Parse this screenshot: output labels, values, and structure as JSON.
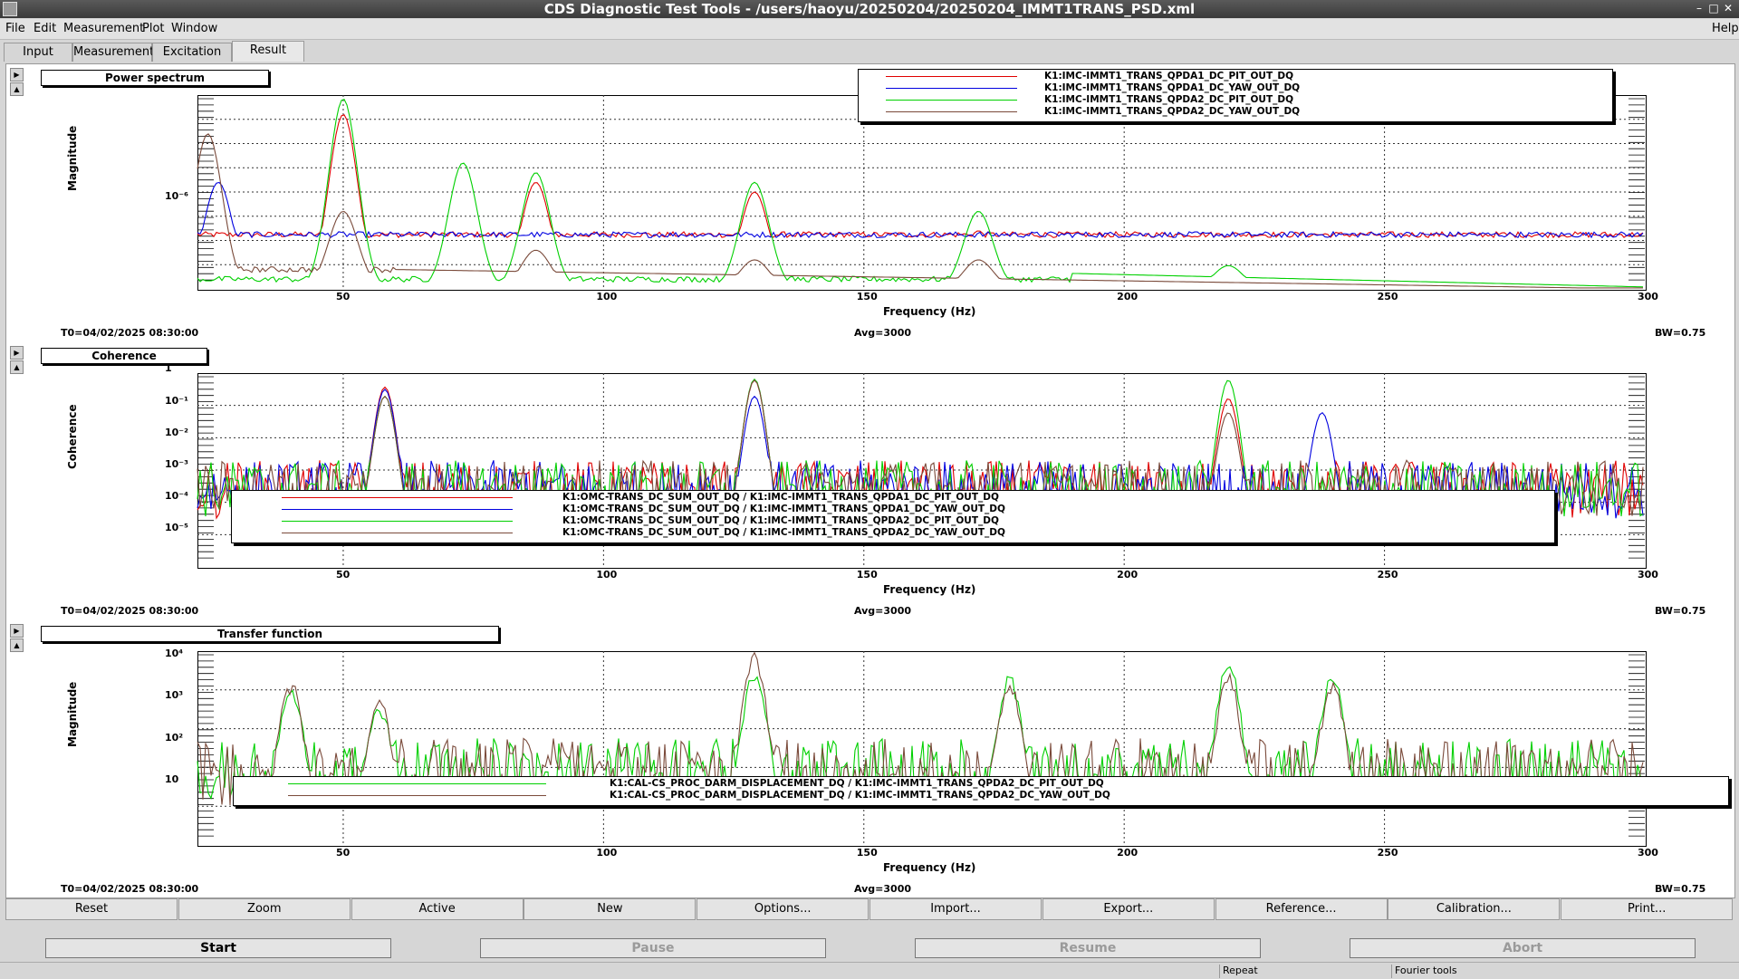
{
  "window": {
    "title": "CDS Diagnostic Test Tools - /users/haoyu/20250204/20250204_IMMT1TRANS_PSD.xml"
  },
  "menu": {
    "file": "File",
    "edit": "Edit",
    "measurement": "Measurement",
    "plot": "Plot",
    "window": "Window",
    "help": "Help"
  },
  "tabs": [
    {
      "label": "Input"
    },
    {
      "label": "Measurement"
    },
    {
      "label": "Excitation"
    },
    {
      "label": "Result",
      "active": true
    }
  ],
  "panels": [
    {
      "title": "Power spectrum",
      "ylabel": "Magnitude",
      "xlabel": "Frequency (Hz)",
      "xticks": [
        "50",
        "100",
        "150",
        "200",
        "250",
        "300"
      ],
      "yticks": [
        "10⁻⁶"
      ],
      "footer": {
        "t0": "T0=04/02/2025 08:30:00",
        "avg": "Avg=3000",
        "bw": "BW=0.75"
      },
      "legend": [
        {
          "label": "K1:IMC-IMMT1_TRANS_QPDA1_DC_PIT_OUT_DQ",
          "color": "#e00000"
        },
        {
          "label": "K1:IMC-IMMT1_TRANS_QPDA1_DC_YAW_OUT_DQ",
          "color": "#0000e0"
        },
        {
          "label": "K1:IMC-IMMT1_TRANS_QPDA2_DC_PIT_OUT_DQ",
          "color": "#00d000"
        },
        {
          "label": "K1:IMC-IMMT1_TRANS_QPDA2_DC_YAW_OUT_DQ",
          "color": "#7a4a3a"
        }
      ]
    },
    {
      "title": "Coherence",
      "ylabel": "Coherence",
      "xlabel": "Frequency (Hz)",
      "xticks": [
        "50",
        "100",
        "150",
        "200",
        "250",
        "300"
      ],
      "yticks": [
        "1",
        "10⁻¹",
        "10⁻²",
        "10⁻³",
        "10⁻⁴",
        "10⁻⁵"
      ],
      "footer": {
        "t0": "T0=04/02/2025 08:30:00",
        "avg": "Avg=3000",
        "bw": "BW=0.75"
      },
      "legend": [
        {
          "label": "K1:OMC-TRANS_DC_SUM_OUT_DQ / K1:IMC-IMMT1_TRANS_QPDA1_DC_PIT_OUT_DQ",
          "color": "#e00000"
        },
        {
          "label": "K1:OMC-TRANS_DC_SUM_OUT_DQ / K1:IMC-IMMT1_TRANS_QPDA1_DC_YAW_OUT_DQ",
          "color": "#0000e0"
        },
        {
          "label": "K1:OMC-TRANS_DC_SUM_OUT_DQ / K1:IMC-IMMT1_TRANS_QPDA2_DC_PIT_OUT_DQ",
          "color": "#00d000"
        },
        {
          "label": "K1:OMC-TRANS_DC_SUM_OUT_DQ / K1:IMC-IMMT1_TRANS_QPDA2_DC_YAW_OUT_DQ",
          "color": "#7a4a3a"
        }
      ]
    },
    {
      "title": "Transfer function",
      "ylabel": "Magnitude",
      "xlabel": "Frequency (Hz)",
      "xticks": [
        "50",
        "100",
        "150",
        "200",
        "250",
        "300"
      ],
      "yticks": [
        "10⁴",
        "10³",
        "10²",
        "10"
      ],
      "footer": {
        "t0": "T0=04/02/2025 08:30:00",
        "avg": "Avg=3000",
        "bw": "BW=0.75"
      },
      "legend": [
        {
          "label": "K1:CAL-CS_PROC_DARM_DISPLACEMENT_DQ / K1:IMC-IMMT1_TRANS_QPDA2_DC_PIT_OUT_DQ",
          "color": "#00d000"
        },
        {
          "label": "K1:CAL-CS_PROC_DARM_DISPLACEMENT_DQ / K1:IMC-IMMT1_TRANS_QPDA2_DC_YAW_OUT_DQ",
          "color": "#7a4a3a"
        }
      ]
    }
  ],
  "toolbar": [
    "Reset",
    "Zoom",
    "Active",
    "New",
    "Options...",
    "Import...",
    "Export...",
    "Reference...",
    "Calibration...",
    "Print..."
  ],
  "controls": {
    "start": "Start",
    "pause": "Pause",
    "resume": "Resume",
    "abort": "Abort"
  },
  "status": {
    "repeat": "Repeat",
    "fourier": "Fourier tools"
  },
  "chart_data": [
    {
      "type": "line",
      "title": "Power spectrum",
      "xlabel": "Frequency (Hz)",
      "ylabel": "Magnitude",
      "xlim": [
        22,
        300
      ],
      "log_y": true,
      "series": [
        {
          "name": "K1:IMC-IMMT1_TRANS_QPDA1_DC_PIT_OUT_DQ",
          "color": "#e00000",
          "peaks": [
            [
              50,
              0.9
            ],
            [
              87,
              0.55
            ],
            [
              129,
              0.5
            ],
            [
              172,
              0.3
            ]
          ],
          "base": 0.28
        },
        {
          "name": "K1:IMC-IMMT1_TRANS_QPDA1_DC_YAW_OUT_DQ",
          "color": "#0000e0",
          "peaks": [
            [
              26,
              0.55
            ],
            [
              49,
              0.15
            ],
            [
              165,
              0.05
            ]
          ],
          "base": 0.28
        },
        {
          "name": "K1:IMC-IMMT1_TRANS_QPDA2_DC_PIT_OUT_DQ",
          "color": "#00d000",
          "peaks": [
            [
              50,
              0.98
            ],
            [
              73,
              0.65
            ],
            [
              87,
              0.6
            ],
            [
              129,
              0.55
            ],
            [
              172,
              0.4
            ],
            [
              220,
              0.12
            ]
          ],
          "base": 0.05
        },
        {
          "name": "K1:IMC-IMMT1_TRANS_QPDA2_DC_YAW_OUT_DQ",
          "color": "#7a4a3a",
          "peaks": [
            [
              24,
              0.8
            ],
            [
              50,
              0.4
            ],
            [
              87,
              0.2
            ],
            [
              129,
              0.15
            ],
            [
              172,
              0.15
            ]
          ],
          "base": 0.1
        }
      ]
    },
    {
      "type": "line",
      "title": "Coherence",
      "xlabel": "Frequency (Hz)",
      "ylabel": "Coherence",
      "xlim": [
        22,
        300
      ],
      "ylim": [
        1e-05,
        1
      ],
      "log_y": true,
      "series": [
        {
          "name": "K1:OMC-TRANS_DC_SUM_OUT_DQ / K1:IMC-IMMT1_TRANS_QPDA1_DC_PIT_OUT_DQ",
          "color": "#e00000",
          "peaks": [
            [
              58,
              0.25
            ],
            [
              129,
              0.5
            ],
            [
              220,
              0.08
            ]
          ]
        },
        {
          "name": "K1:OMC-TRANS_DC_SUM_OUT_DQ / K1:IMC-IMMT1_TRANS_QPDA1_DC_YAW_OUT_DQ",
          "color": "#0000e0",
          "peaks": [
            [
              58,
              0.2
            ],
            [
              129,
              0.1
            ],
            [
              238,
              0.02
            ]
          ]
        },
        {
          "name": "K1:OMC-TRANS_DC_SUM_OUT_DQ / K1:IMC-IMMT1_TRANS_QPDA2_DC_PIT_OUT_DQ",
          "color": "#00d000",
          "peaks": [
            [
              58,
              0.1
            ],
            [
              129,
              0.55
            ],
            [
              220,
              0.5
            ]
          ]
        },
        {
          "name": "K1:OMC-TRANS_DC_SUM_OUT_DQ / K1:IMC-IMMT1_TRANS_QPDA2_DC_YAW_OUT_DQ",
          "color": "#7a4a3a",
          "peaks": [
            [
              58,
              0.1
            ],
            [
              129,
              0.5
            ],
            [
              220,
              0.02
            ]
          ]
        }
      ]
    },
    {
      "type": "line",
      "title": "Transfer function",
      "xlabel": "Frequency (Hz)",
      "ylabel": "Magnitude",
      "xlim": [
        22,
        300
      ],
      "ylim": [
        5,
        20000
      ],
      "log_y": true,
      "series": [
        {
          "name": "K1:CAL-CS_PROC_DARM_DISPLACEMENT_DQ / K1:IMC-IMMT1_TRANS_QPDA2_DC_PIT_OUT_DQ",
          "color": "#00d000",
          "peaks": [
            [
              40,
              1500
            ],
            [
              57,
              700
            ],
            [
              129,
              4000
            ],
            [
              178,
              3000
            ],
            [
              220,
              6000
            ],
            [
              240,
              3500
            ]
          ]
        },
        {
          "name": "K1:CAL-CS_PROC_DARM_DISPLACEMENT_DQ / K1:IMC-IMMT1_TRANS_QPDA2_DC_YAW_OUT_DQ",
          "color": "#7a4a3a",
          "peaks": [
            [
              40,
              2000
            ],
            [
              57,
              800
            ],
            [
              129,
              9000
            ],
            [
              178,
              2000
            ],
            [
              220,
              3000
            ],
            [
              240,
              2000
            ]
          ]
        }
      ]
    }
  ]
}
